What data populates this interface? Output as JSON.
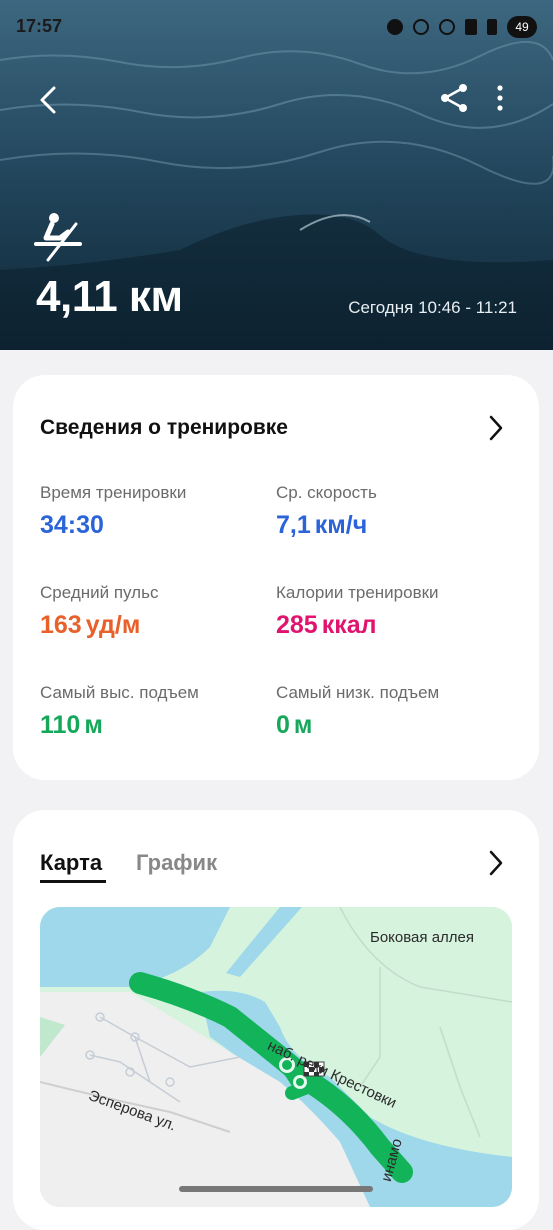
{
  "status_bar": {
    "time": "17:57",
    "battery": "49"
  },
  "hero": {
    "distance": "4,11 км",
    "datetime": "Сегодня 10:46 - 11:21",
    "icons": [
      "back-arrow-icon",
      "share-icon",
      "more-vert-icon",
      "rowing-icon"
    ]
  },
  "details": {
    "title": "Сведения о тренировке",
    "stats": [
      {
        "label": "Время тренировки",
        "value": "34:30",
        "unit": "",
        "color": "#2b63d9"
      },
      {
        "label": "Ср. скорость",
        "value": "7,1",
        "unit": "км/ч",
        "color": "#2b63d9"
      },
      {
        "label": "Средний пульс",
        "value": "163",
        "unit": "уд/м",
        "color": "#e8602a"
      },
      {
        "label": "Калории тренировки",
        "value": "285",
        "unit": "ккал",
        "color": "#e0146f"
      },
      {
        "label": "Самый выс. подъем",
        "value": "110",
        "unit": "м",
        "color": "#16a85a"
      },
      {
        "label": "Самый низк. подъем",
        "value": "0",
        "unit": "м",
        "color": "#16a85a"
      }
    ]
  },
  "map_card": {
    "tabs": [
      {
        "label": "Карта",
        "active": true
      },
      {
        "label": "График",
        "active": false
      }
    ],
    "map_labels": {
      "alley": "Боковая аллея",
      "embankment": "наб. реки Крестовки",
      "street": "Эсперова ул.",
      "dynamo": "инамо"
    }
  },
  "colors": {
    "route": "#13b35a",
    "water": "#9fd8ea",
    "park": "#d6f3de",
    "land": "#efefef"
  }
}
